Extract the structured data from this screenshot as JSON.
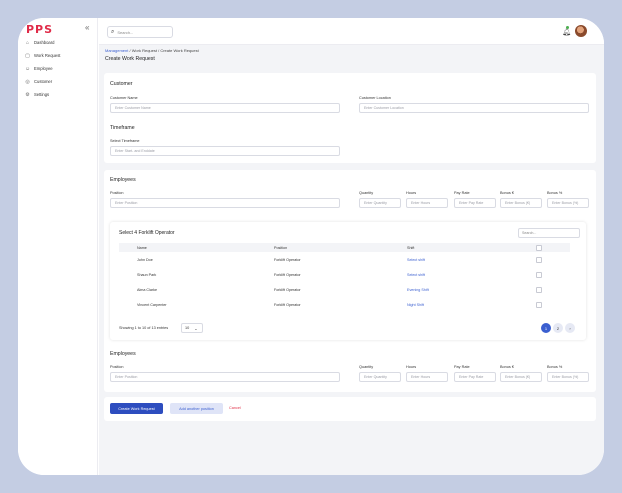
{
  "brand": "PPS",
  "sidebar": {
    "items": [
      {
        "label": "Dashboard",
        "icon": "home-icon"
      },
      {
        "label": "Work Request",
        "icon": "clipboard-icon"
      },
      {
        "label": "Employee",
        "icon": "user-icon"
      },
      {
        "label": "Customer",
        "icon": "customer-icon"
      },
      {
        "label": "Settings",
        "icon": "gear-icon"
      }
    ]
  },
  "topbar": {
    "search_placeholder": "Search..."
  },
  "breadcrumb": {
    "part1": "Management",
    "sep1": " / ",
    "part2": "Work Request",
    "sep2": " / ",
    "part3": "Create Work Request"
  },
  "page_title": "Create Work Request",
  "customer": {
    "heading": "Customer",
    "name_label": "Customer Name",
    "name_placeholder": "Enter Customer Name",
    "location_label": "Customer Location",
    "location_placeholder": "Enter Customer Location"
  },
  "timeframe": {
    "heading": "Timeframe",
    "label": "Select Timeframe",
    "placeholder": "Enter Start- and Enddate"
  },
  "employees1": {
    "heading": "Employees",
    "labels": {
      "position": "Position",
      "quantity": "Quantity",
      "hours": "Hours",
      "pay_rate": "Pay Rate",
      "bonus_eur": "Bonus €",
      "bonus_pct": "Bonus %"
    },
    "placeholders": {
      "position": "Enter Position",
      "quantity": "Enter Quantity",
      "hours": "Enter Hours",
      "pay_rate": "Enter Pay Rate",
      "bonus_eur": "Enter Bonus (€)",
      "bonus_pct": "Enter Bonus (%)"
    }
  },
  "select_table": {
    "title": "Select 4 Forklift Operator",
    "search_placeholder": "Search...",
    "headers": {
      "name": "Name",
      "position": "Position",
      "shift": "Shift"
    },
    "rows": [
      {
        "name": "John Doe",
        "position": "Forklift Operator",
        "shift": "Select shift"
      },
      {
        "name": "Shaun Park",
        "position": "Forklift Operator",
        "shift": "Select shift"
      },
      {
        "name": "Alma Clarke",
        "position": "Forklift Operator",
        "shift": "Evening Shift"
      },
      {
        "name": "Vincent Carpenter",
        "position": "Forklift Operator",
        "shift": "Night Shift"
      }
    ],
    "showing": "Showing 1 to 10 of 13 entries",
    "page_size": "10",
    "pages": [
      "1",
      "2"
    ],
    "next": "›"
  },
  "employees2": {
    "heading": "Employees",
    "labels": {
      "position": "Position",
      "quantity": "Quantity",
      "hours": "Hours",
      "pay_rate": "Pay Rate",
      "bonus_eur": "Bonus €",
      "bonus_pct": "Bonus %"
    },
    "placeholders": {
      "position": "Enter Position",
      "quantity": "Enter Quantity",
      "hours": "Enter Hours",
      "pay_rate": "Enter Pay Rate",
      "bonus_eur": "Enter Bonus (€)",
      "bonus_pct": "Enter Bonus (%)"
    }
  },
  "actions": {
    "create": "Create Work Request",
    "add": "Add another position",
    "cancel": "Cancel"
  },
  "colors": {
    "brand": "#e02b48",
    "primary": "#2d4dbf",
    "link": "#3b5fd0",
    "danger": "#e0334a"
  }
}
